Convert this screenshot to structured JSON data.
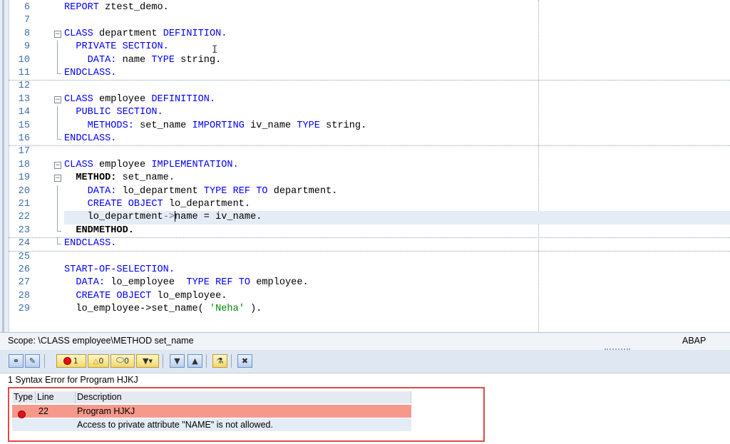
{
  "editor": {
    "lines": [
      {
        "n": "6",
        "tokens": [
          {
            "t": "REPORT",
            "c": "kw"
          },
          {
            "t": " ztest_demo."
          }
        ]
      },
      {
        "n": "7",
        "tokens": []
      },
      {
        "n": "8",
        "fold": "box",
        "tokens": [
          {
            "t": "CLASS",
            "c": "kw"
          },
          {
            "t": " department "
          },
          {
            "t": "DEFINITION.",
            "c": "kw"
          }
        ]
      },
      {
        "n": "9",
        "fold": "vline",
        "tokens": [
          {
            "t": "  PRIVATE SECTION.",
            "c": "kw"
          }
        ]
      },
      {
        "n": "10",
        "fold": "vline",
        "tokens": [
          {
            "t": "    DATA:",
            "c": "kw"
          },
          {
            "t": " name "
          },
          {
            "t": "TYPE",
            "c": "kw"
          },
          {
            "t": " string."
          }
        ]
      },
      {
        "n": "11",
        "fold": "end",
        "sep": true,
        "tokens": [
          {
            "t": "ENDCLASS.",
            "c": "kw"
          }
        ]
      },
      {
        "n": "12",
        "tokens": []
      },
      {
        "n": "13",
        "fold": "box",
        "tokens": [
          {
            "t": "CLASS",
            "c": "kw"
          },
          {
            "t": " employee "
          },
          {
            "t": "DEFINITION.",
            "c": "kw"
          }
        ]
      },
      {
        "n": "14",
        "fold": "vline",
        "tokens": [
          {
            "t": "  PUBLIC SECTION.",
            "c": "kw"
          }
        ]
      },
      {
        "n": "15",
        "fold": "vline",
        "tokens": [
          {
            "t": "    METHODS:",
            "c": "kw"
          },
          {
            "t": " set_name "
          },
          {
            "t": "IMPORTING",
            "c": "kw"
          },
          {
            "t": " iv_name "
          },
          {
            "t": "TYPE",
            "c": "kw"
          },
          {
            "t": " string."
          }
        ]
      },
      {
        "n": "16",
        "fold": "end",
        "sep": true,
        "tokens": [
          {
            "t": "ENDCLASS.",
            "c": "kw"
          }
        ]
      },
      {
        "n": "17",
        "tokens": []
      },
      {
        "n": "18",
        "fold": "box",
        "tokens": [
          {
            "t": "CLASS",
            "c": "kw"
          },
          {
            "t": " employee "
          },
          {
            "t": "IMPLEMENTATION.",
            "c": "kw"
          }
        ]
      },
      {
        "n": "19",
        "fold": "box",
        "tokens": [
          {
            "t": "  METHOD:",
            "c": "kwb"
          },
          {
            "t": " set_name."
          }
        ]
      },
      {
        "n": "20",
        "fold": "vline",
        "tokens": [
          {
            "t": "    DATA:",
            "c": "kw"
          },
          {
            "t": " lo_department "
          },
          {
            "t": "TYPE REF TO",
            "c": "kw"
          },
          {
            "t": " department."
          }
        ]
      },
      {
        "n": "21",
        "fold": "vline",
        "tokens": [
          {
            "t": "    CREATE OBJECT",
            "c": "kw"
          },
          {
            "t": " lo_department."
          }
        ]
      },
      {
        "n": "22",
        "fold": "vline",
        "current": true,
        "tokens": [
          {
            "t": "    lo_department"
          },
          {
            "t": "->",
            "c": "ptr"
          },
          {
            "caret": true
          },
          {
            "t": "name = iv_name."
          }
        ]
      },
      {
        "n": "23",
        "fold": "end",
        "sep": true,
        "tokens": [
          {
            "t": "  ENDMETHOD.",
            "c": "kwb"
          }
        ]
      },
      {
        "n": "24",
        "fold": "end",
        "sep": true,
        "tokens": [
          {
            "t": "ENDCLASS.",
            "c": "kw"
          }
        ]
      },
      {
        "n": "25",
        "tokens": []
      },
      {
        "n": "26",
        "tokens": [
          {
            "t": "START-OF-SELECTION.",
            "c": "kw"
          }
        ]
      },
      {
        "n": "27",
        "tokens": [
          {
            "t": "  DATA:",
            "c": "kw"
          },
          {
            "t": " lo_employee  "
          },
          {
            "t": "TYPE REF TO",
            "c": "kw"
          },
          {
            "t": " employee."
          }
        ]
      },
      {
        "n": "28",
        "tokens": [
          {
            "t": "  CREATE OBJECT",
            "c": "kw"
          },
          {
            "t": " lo_employee."
          }
        ]
      },
      {
        "n": "29",
        "tokens": [
          {
            "t": "  lo_employee->set_name( "
          },
          {
            "t": "'Neha'",
            "c": "str"
          },
          {
            "t": " )."
          }
        ]
      }
    ]
  },
  "scope": {
    "text": "Scope: \\CLASS employee\\METHOD set_name",
    "language": "ABAP"
  },
  "toolbar": {
    "error_count": "1",
    "warning_count": "0",
    "info_count": "0"
  },
  "errors": {
    "title": "1 Syntax Error for Program HJKJ",
    "columns": {
      "type": "Type",
      "line": "Line",
      "description": "Description"
    },
    "rows": [
      {
        "line": "22",
        "description": "Program HJKJ"
      },
      {
        "line": "",
        "description": "Access to private attribute \"NAME\" is not allowed."
      }
    ]
  },
  "colors": {
    "error_row": "#f6998c",
    "highlight_border": "#e04a48",
    "keyword": "#0000ff",
    "string": "#008800"
  }
}
